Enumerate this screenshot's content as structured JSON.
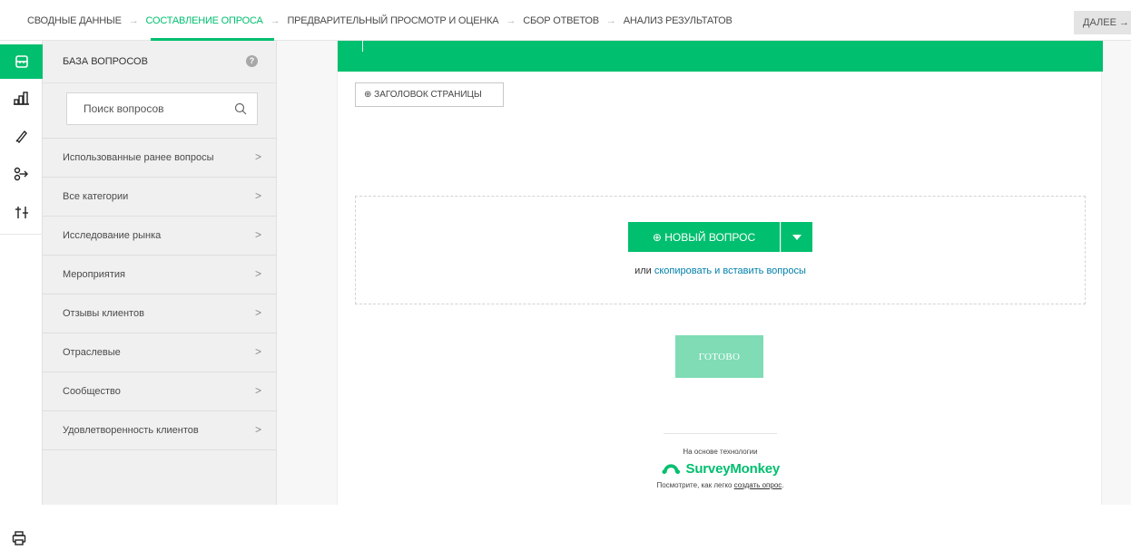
{
  "steps": {
    "items": [
      "СВОДНЫЕ ДАННЫЕ",
      "СОСТАВЛЕНИЕ ОПРОСА",
      "ПРЕДВАРИТЕЛЬНЫЙ ПРОСМОТР И ОЦЕНКА",
      "СБОР ОТВЕТОВ",
      "АНАЛИЗ РЕЗУЛЬТАТОВ"
    ],
    "active_index": 1,
    "separator": "→",
    "next_label": "ДАЛЕЕ →"
  },
  "rail": {
    "icons": [
      "question-bank-icon",
      "logic-icon",
      "design-icon",
      "branching-icon",
      "options-icon"
    ],
    "active": "question-bank-icon"
  },
  "library": {
    "title": "БАЗА ВОПРОСОВ",
    "help_glyph": "?",
    "search_placeholder": "Поиск вопросов",
    "categories": [
      "Использованные ранее вопросы",
      "Все категории",
      "Исследование рынка",
      "Мероприятия",
      "Отзывы клиентов",
      "Отраслевые",
      "Сообщество",
      "Удовлетворенность клиентов"
    ],
    "chevron": ">"
  },
  "survey": {
    "page_title_button": "⊕ ЗАГОЛОВОК СТРАНИЦЫ",
    "new_question_label": "⊕  НОВЫЙ ВОПРОС",
    "copy_prefix": "или ",
    "copy_link": "скопировать и вставить вопросы",
    "done_label": "ГОТОВО",
    "powered_by": "На основе технологии",
    "brand": "SurveyMonkey",
    "see_how_prefix": "Посмотрите, как легко ",
    "see_how_link": "создать опрос",
    "see_how_suffix": "."
  },
  "colors": {
    "accent": "#00bf6f",
    "done_disabled": "#7fdcb5",
    "link": "#007faa"
  }
}
